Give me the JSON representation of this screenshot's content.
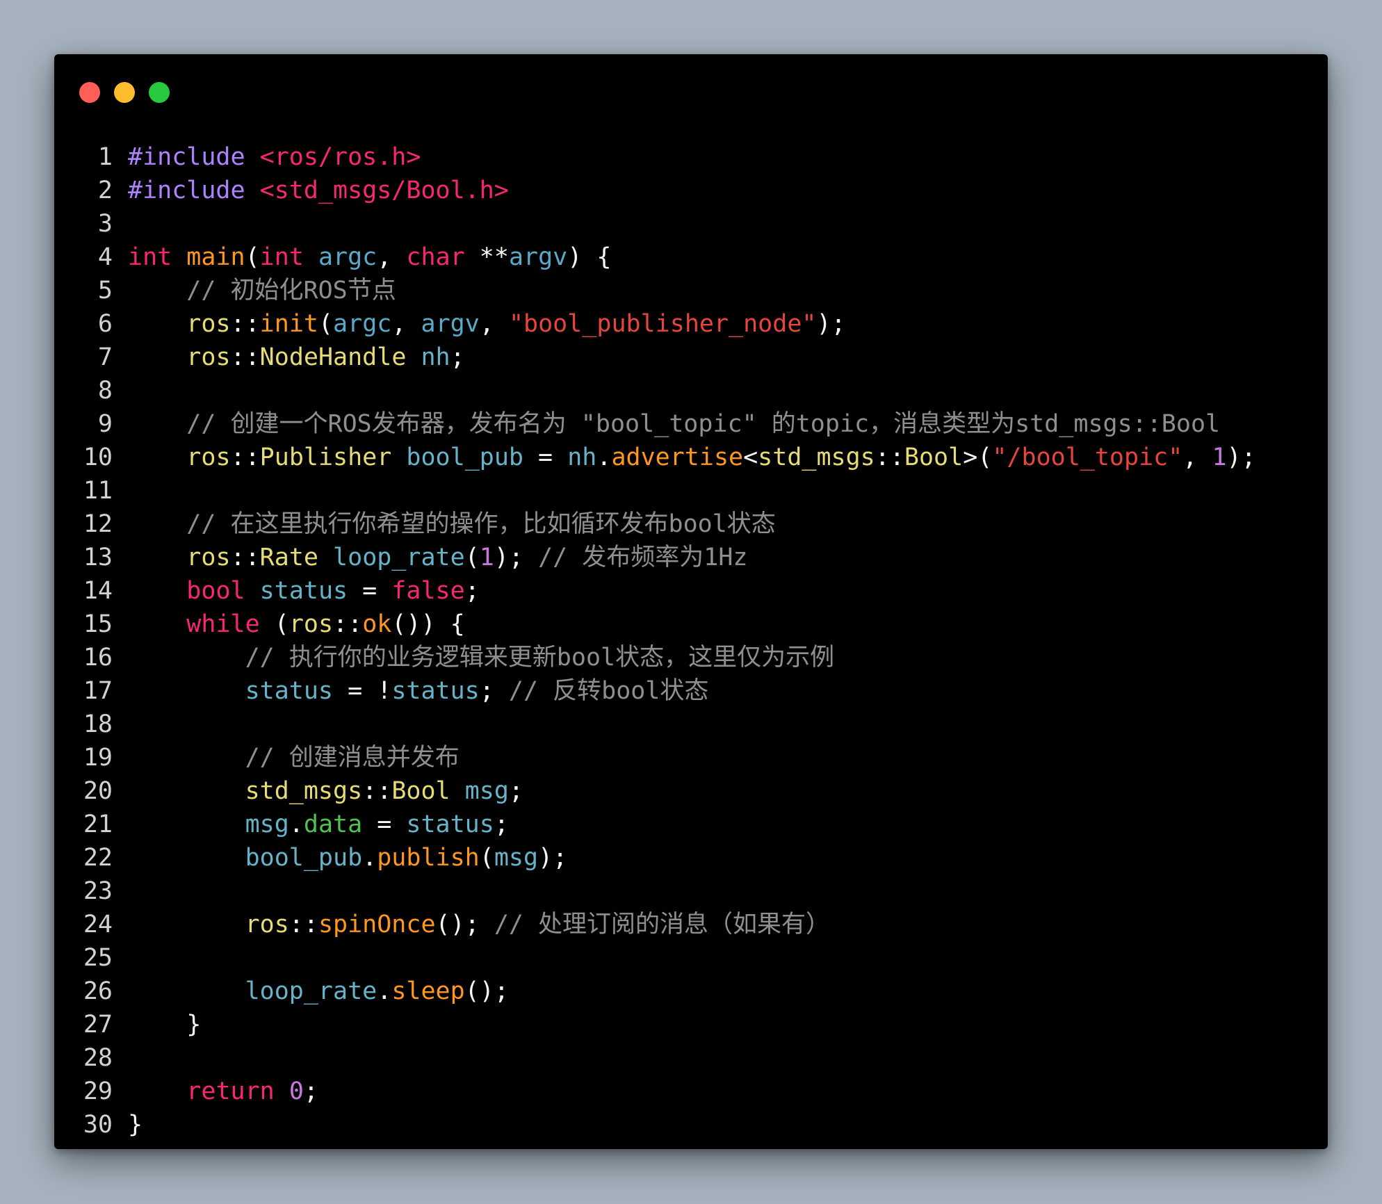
{
  "window": {
    "controls": [
      "close",
      "minimize",
      "maximize"
    ],
    "colors": {
      "close": "#ff5f56",
      "minimize": "#ffbd2e",
      "maximize": "#27c93f",
      "background": "#000000"
    }
  },
  "code_lines": [
    {
      "n": "1",
      "tokens": [
        [
          "pp",
          "#include"
        ],
        [
          "p",
          " "
        ],
        [
          "hs",
          "<ros/ros.h>"
        ]
      ]
    },
    {
      "n": "2",
      "tokens": [
        [
          "pp",
          "#include"
        ],
        [
          "p",
          " "
        ],
        [
          "hs",
          "<std_msgs/Bool.h>"
        ]
      ]
    },
    {
      "n": "3",
      "tokens": []
    },
    {
      "n": "4",
      "tokens": [
        [
          "k",
          "int"
        ],
        [
          "p",
          " "
        ],
        [
          "f",
          "main"
        ],
        [
          "p",
          "("
        ],
        [
          "k",
          "int"
        ],
        [
          "p",
          " "
        ],
        [
          "v2",
          "argc"
        ],
        [
          "p",
          ", "
        ],
        [
          "k",
          "char"
        ],
        [
          "p",
          " **"
        ],
        [
          "v2",
          "argv"
        ],
        [
          "p",
          ") {"
        ]
      ]
    },
    {
      "n": "5",
      "tokens": [
        [
          "p",
          "    "
        ],
        [
          "c",
          "// 初始化ROS节点"
        ]
      ]
    },
    {
      "n": "6",
      "tokens": [
        [
          "p",
          "    "
        ],
        [
          "t",
          "ros"
        ],
        [
          "p",
          "::"
        ],
        [
          "f",
          "init"
        ],
        [
          "p",
          "("
        ],
        [
          "v2",
          "argc"
        ],
        [
          "p",
          ", "
        ],
        [
          "v2",
          "argv"
        ],
        [
          "p",
          ", "
        ],
        [
          "s",
          "\"bool_publisher_node\""
        ],
        [
          "p",
          ");"
        ]
      ]
    },
    {
      "n": "7",
      "tokens": [
        [
          "p",
          "    "
        ],
        [
          "t",
          "ros"
        ],
        [
          "p",
          "::"
        ],
        [
          "t",
          "NodeHandle"
        ],
        [
          "p",
          " "
        ],
        [
          "v",
          "nh"
        ],
        [
          "p",
          ";"
        ]
      ]
    },
    {
      "n": "8",
      "tokens": []
    },
    {
      "n": "9",
      "tokens": [
        [
          "p",
          "    "
        ],
        [
          "c",
          "// 创建一个ROS发布器，发布名为 \"bool_topic\" 的topic，消息类型为std_msgs::Bool"
        ]
      ]
    },
    {
      "n": "10",
      "tokens": [
        [
          "p",
          "    "
        ],
        [
          "t",
          "ros"
        ],
        [
          "p",
          "::"
        ],
        [
          "t",
          "Publisher"
        ],
        [
          "p",
          " "
        ],
        [
          "v",
          "bool_pub"
        ],
        [
          "p",
          " = "
        ],
        [
          "v",
          "nh"
        ],
        [
          "p",
          "."
        ],
        [
          "f",
          "advertise"
        ],
        [
          "p",
          "<"
        ],
        [
          "t",
          "std_msgs"
        ],
        [
          "p",
          "::"
        ],
        [
          "t",
          "Bool"
        ],
        [
          "p",
          ">("
        ],
        [
          "s",
          "\"/bool_topic\""
        ],
        [
          "p",
          ", "
        ],
        [
          "n",
          "1"
        ],
        [
          "p",
          ");"
        ]
      ]
    },
    {
      "n": "11",
      "tokens": []
    },
    {
      "n": "12",
      "tokens": [
        [
          "p",
          "    "
        ],
        [
          "c",
          "// 在这里执行你希望的操作，比如循环发布bool状态"
        ]
      ]
    },
    {
      "n": "13",
      "tokens": [
        [
          "p",
          "    "
        ],
        [
          "t",
          "ros"
        ],
        [
          "p",
          "::"
        ],
        [
          "t",
          "Rate"
        ],
        [
          "p",
          " "
        ],
        [
          "v",
          "loop_rate"
        ],
        [
          "p",
          "("
        ],
        [
          "n",
          "1"
        ],
        [
          "p",
          "); "
        ],
        [
          "c",
          "// 发布频率为1Hz"
        ]
      ]
    },
    {
      "n": "14",
      "tokens": [
        [
          "p",
          "    "
        ],
        [
          "k",
          "bool"
        ],
        [
          "p",
          " "
        ],
        [
          "v",
          "status"
        ],
        [
          "p",
          " = "
        ],
        [
          "k",
          "false"
        ],
        [
          "p",
          ";"
        ]
      ]
    },
    {
      "n": "15",
      "tokens": [
        [
          "p",
          "    "
        ],
        [
          "k",
          "while"
        ],
        [
          "p",
          " ("
        ],
        [
          "t",
          "ros"
        ],
        [
          "p",
          "::"
        ],
        [
          "f",
          "ok"
        ],
        [
          "p",
          "()) {"
        ]
      ]
    },
    {
      "n": "16",
      "tokens": [
        [
          "p",
          "        "
        ],
        [
          "c",
          "// 执行你的业务逻辑来更新bool状态，这里仅为示例"
        ]
      ]
    },
    {
      "n": "17",
      "tokens": [
        [
          "p",
          "        "
        ],
        [
          "v",
          "status"
        ],
        [
          "p",
          " = !"
        ],
        [
          "v",
          "status"
        ],
        [
          "p",
          "; "
        ],
        [
          "c",
          "// 反转bool状态"
        ]
      ]
    },
    {
      "n": "18",
      "tokens": []
    },
    {
      "n": "19",
      "tokens": [
        [
          "p",
          "        "
        ],
        [
          "c",
          "// 创建消息并发布"
        ]
      ]
    },
    {
      "n": "20",
      "tokens": [
        [
          "p",
          "        "
        ],
        [
          "t",
          "std_msgs"
        ],
        [
          "p",
          "::"
        ],
        [
          "t",
          "Bool"
        ],
        [
          "p",
          " "
        ],
        [
          "v",
          "msg"
        ],
        [
          "p",
          ";"
        ]
      ]
    },
    {
      "n": "21",
      "tokens": [
        [
          "p",
          "        "
        ],
        [
          "v",
          "msg"
        ],
        [
          "p",
          "."
        ],
        [
          "m",
          "data"
        ],
        [
          "p",
          " = "
        ],
        [
          "v",
          "status"
        ],
        [
          "p",
          ";"
        ]
      ]
    },
    {
      "n": "22",
      "tokens": [
        [
          "p",
          "        "
        ],
        [
          "v",
          "bool_pub"
        ],
        [
          "p",
          "."
        ],
        [
          "f",
          "publish"
        ],
        [
          "p",
          "("
        ],
        [
          "v",
          "msg"
        ],
        [
          "p",
          ");"
        ]
      ]
    },
    {
      "n": "23",
      "tokens": []
    },
    {
      "n": "24",
      "tokens": [
        [
          "p",
          "        "
        ],
        [
          "t",
          "ros"
        ],
        [
          "p",
          "::"
        ],
        [
          "f",
          "spinOnce"
        ],
        [
          "p",
          "(); "
        ],
        [
          "c",
          "// 处理订阅的消息（如果有）"
        ]
      ]
    },
    {
      "n": "25",
      "tokens": []
    },
    {
      "n": "26",
      "tokens": [
        [
          "p",
          "        "
        ],
        [
          "v",
          "loop_rate"
        ],
        [
          "p",
          "."
        ],
        [
          "f",
          "sleep"
        ],
        [
          "p",
          "();"
        ]
      ]
    },
    {
      "n": "27",
      "tokens": [
        [
          "p",
          "    }"
        ]
      ]
    },
    {
      "n": "28",
      "tokens": []
    },
    {
      "n": "29",
      "tokens": [
        [
          "p",
          "    "
        ],
        [
          "k",
          "return"
        ],
        [
          "p",
          " "
        ],
        [
          "n",
          "0"
        ],
        [
          "p",
          ";"
        ]
      ]
    },
    {
      "n": "30",
      "tokens": [
        [
          "p",
          "}"
        ]
      ]
    }
  ]
}
